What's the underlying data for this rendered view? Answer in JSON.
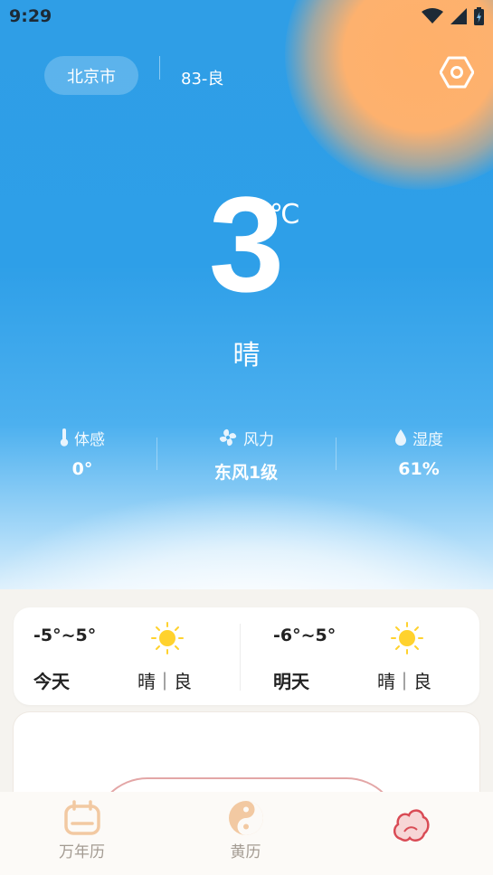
{
  "status_bar": {
    "time": "9:29"
  },
  "header": {
    "city": "北京市",
    "aqi": "83-良"
  },
  "current": {
    "temperature": "3",
    "unit": "℃",
    "condition": "晴"
  },
  "metrics": [
    {
      "icon": "thermometer-icon",
      "label": "体感",
      "value": "0°"
    },
    {
      "icon": "fan-icon",
      "label": "风力",
      "value": "东风1级"
    },
    {
      "icon": "droplet-icon",
      "label": "湿度",
      "value": "61%"
    }
  ],
  "forecast": [
    {
      "range": "-5°~5°",
      "day": "今天",
      "condition": "晴｜良",
      "icon": "sun-icon"
    },
    {
      "range": "-6°~5°",
      "day": "明天",
      "condition": "晴｜良",
      "icon": "sun-icon"
    }
  ],
  "tabs": [
    {
      "label": "万年历",
      "icon": "calendar-icon"
    },
    {
      "label": "黄历",
      "icon": "yin-yang-icon"
    },
    {
      "label": "",
      "icon": "weather-cloud-icon"
    }
  ],
  "colors": {
    "sky": "#2f9ee6",
    "sun": "#fdb16e",
    "tab_inactive": "#a39b92",
    "tab_active": "#d94b55"
  }
}
